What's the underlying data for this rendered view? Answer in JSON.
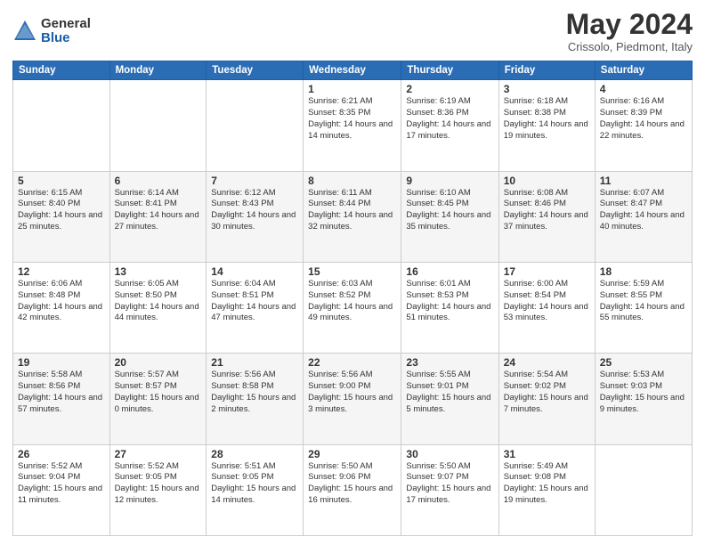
{
  "header": {
    "logo_general": "General",
    "logo_blue": "Blue",
    "title": "May 2024",
    "location": "Crissolo, Piedmont, Italy"
  },
  "weekdays": [
    "Sunday",
    "Monday",
    "Tuesday",
    "Wednesday",
    "Thursday",
    "Friday",
    "Saturday"
  ],
  "weeks": [
    [
      {
        "day": "",
        "info": ""
      },
      {
        "day": "",
        "info": ""
      },
      {
        "day": "",
        "info": ""
      },
      {
        "day": "1",
        "info": "Sunrise: 6:21 AM\nSunset: 8:35 PM\nDaylight: 14 hours and 14 minutes."
      },
      {
        "day": "2",
        "info": "Sunrise: 6:19 AM\nSunset: 8:36 PM\nDaylight: 14 hours and 17 minutes."
      },
      {
        "day": "3",
        "info": "Sunrise: 6:18 AM\nSunset: 8:38 PM\nDaylight: 14 hours and 19 minutes."
      },
      {
        "day": "4",
        "info": "Sunrise: 6:16 AM\nSunset: 8:39 PM\nDaylight: 14 hours and 22 minutes."
      }
    ],
    [
      {
        "day": "5",
        "info": "Sunrise: 6:15 AM\nSunset: 8:40 PM\nDaylight: 14 hours and 25 minutes."
      },
      {
        "day": "6",
        "info": "Sunrise: 6:14 AM\nSunset: 8:41 PM\nDaylight: 14 hours and 27 minutes."
      },
      {
        "day": "7",
        "info": "Sunrise: 6:12 AM\nSunset: 8:43 PM\nDaylight: 14 hours and 30 minutes."
      },
      {
        "day": "8",
        "info": "Sunrise: 6:11 AM\nSunset: 8:44 PM\nDaylight: 14 hours and 32 minutes."
      },
      {
        "day": "9",
        "info": "Sunrise: 6:10 AM\nSunset: 8:45 PM\nDaylight: 14 hours and 35 minutes."
      },
      {
        "day": "10",
        "info": "Sunrise: 6:08 AM\nSunset: 8:46 PM\nDaylight: 14 hours and 37 minutes."
      },
      {
        "day": "11",
        "info": "Sunrise: 6:07 AM\nSunset: 8:47 PM\nDaylight: 14 hours and 40 minutes."
      }
    ],
    [
      {
        "day": "12",
        "info": "Sunrise: 6:06 AM\nSunset: 8:48 PM\nDaylight: 14 hours and 42 minutes."
      },
      {
        "day": "13",
        "info": "Sunrise: 6:05 AM\nSunset: 8:50 PM\nDaylight: 14 hours and 44 minutes."
      },
      {
        "day": "14",
        "info": "Sunrise: 6:04 AM\nSunset: 8:51 PM\nDaylight: 14 hours and 47 minutes."
      },
      {
        "day": "15",
        "info": "Sunrise: 6:03 AM\nSunset: 8:52 PM\nDaylight: 14 hours and 49 minutes."
      },
      {
        "day": "16",
        "info": "Sunrise: 6:01 AM\nSunset: 8:53 PM\nDaylight: 14 hours and 51 minutes."
      },
      {
        "day": "17",
        "info": "Sunrise: 6:00 AM\nSunset: 8:54 PM\nDaylight: 14 hours and 53 minutes."
      },
      {
        "day": "18",
        "info": "Sunrise: 5:59 AM\nSunset: 8:55 PM\nDaylight: 14 hours and 55 minutes."
      }
    ],
    [
      {
        "day": "19",
        "info": "Sunrise: 5:58 AM\nSunset: 8:56 PM\nDaylight: 14 hours and 57 minutes."
      },
      {
        "day": "20",
        "info": "Sunrise: 5:57 AM\nSunset: 8:57 PM\nDaylight: 15 hours and 0 minutes."
      },
      {
        "day": "21",
        "info": "Sunrise: 5:56 AM\nSunset: 8:58 PM\nDaylight: 15 hours and 2 minutes."
      },
      {
        "day": "22",
        "info": "Sunrise: 5:56 AM\nSunset: 9:00 PM\nDaylight: 15 hours and 3 minutes."
      },
      {
        "day": "23",
        "info": "Sunrise: 5:55 AM\nSunset: 9:01 PM\nDaylight: 15 hours and 5 minutes."
      },
      {
        "day": "24",
        "info": "Sunrise: 5:54 AM\nSunset: 9:02 PM\nDaylight: 15 hours and 7 minutes."
      },
      {
        "day": "25",
        "info": "Sunrise: 5:53 AM\nSunset: 9:03 PM\nDaylight: 15 hours and 9 minutes."
      }
    ],
    [
      {
        "day": "26",
        "info": "Sunrise: 5:52 AM\nSunset: 9:04 PM\nDaylight: 15 hours and 11 minutes."
      },
      {
        "day": "27",
        "info": "Sunrise: 5:52 AM\nSunset: 9:05 PM\nDaylight: 15 hours and 12 minutes."
      },
      {
        "day": "28",
        "info": "Sunrise: 5:51 AM\nSunset: 9:05 PM\nDaylight: 15 hours and 14 minutes."
      },
      {
        "day": "29",
        "info": "Sunrise: 5:50 AM\nSunset: 9:06 PM\nDaylight: 15 hours and 16 minutes."
      },
      {
        "day": "30",
        "info": "Sunrise: 5:50 AM\nSunset: 9:07 PM\nDaylight: 15 hours and 17 minutes."
      },
      {
        "day": "31",
        "info": "Sunrise: 5:49 AM\nSunset: 9:08 PM\nDaylight: 15 hours and 19 minutes."
      },
      {
        "day": "",
        "info": ""
      }
    ]
  ]
}
